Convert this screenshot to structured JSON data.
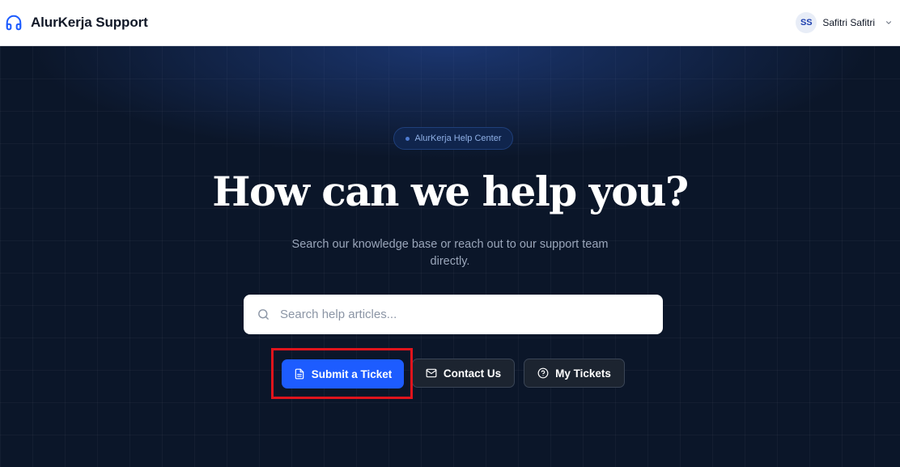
{
  "header": {
    "brand_name": "AlurKerja Support",
    "user_initials": "SS",
    "user_name": "Safitri Safitri"
  },
  "hero": {
    "badge": "AlurKerja Help Center",
    "title": "How can we help you?",
    "subtitle": "Search our knowledge base or reach out to our support team directly.",
    "search_placeholder": "Search help articles..."
  },
  "actions": {
    "submit_ticket": "Submit a Ticket",
    "contact_us": "Contact Us",
    "my_tickets": "My Tickets"
  },
  "colors": {
    "accent": "#1d5cff",
    "hero_background": "#0b1629",
    "highlight": "#e0141c"
  },
  "icons": {
    "brand": "headphones-icon",
    "user_menu": "chevron-down-icon",
    "search": "search-icon",
    "submit_ticket": "document-icon",
    "contact_us": "mail-icon",
    "my_tickets": "help-circle-icon"
  }
}
